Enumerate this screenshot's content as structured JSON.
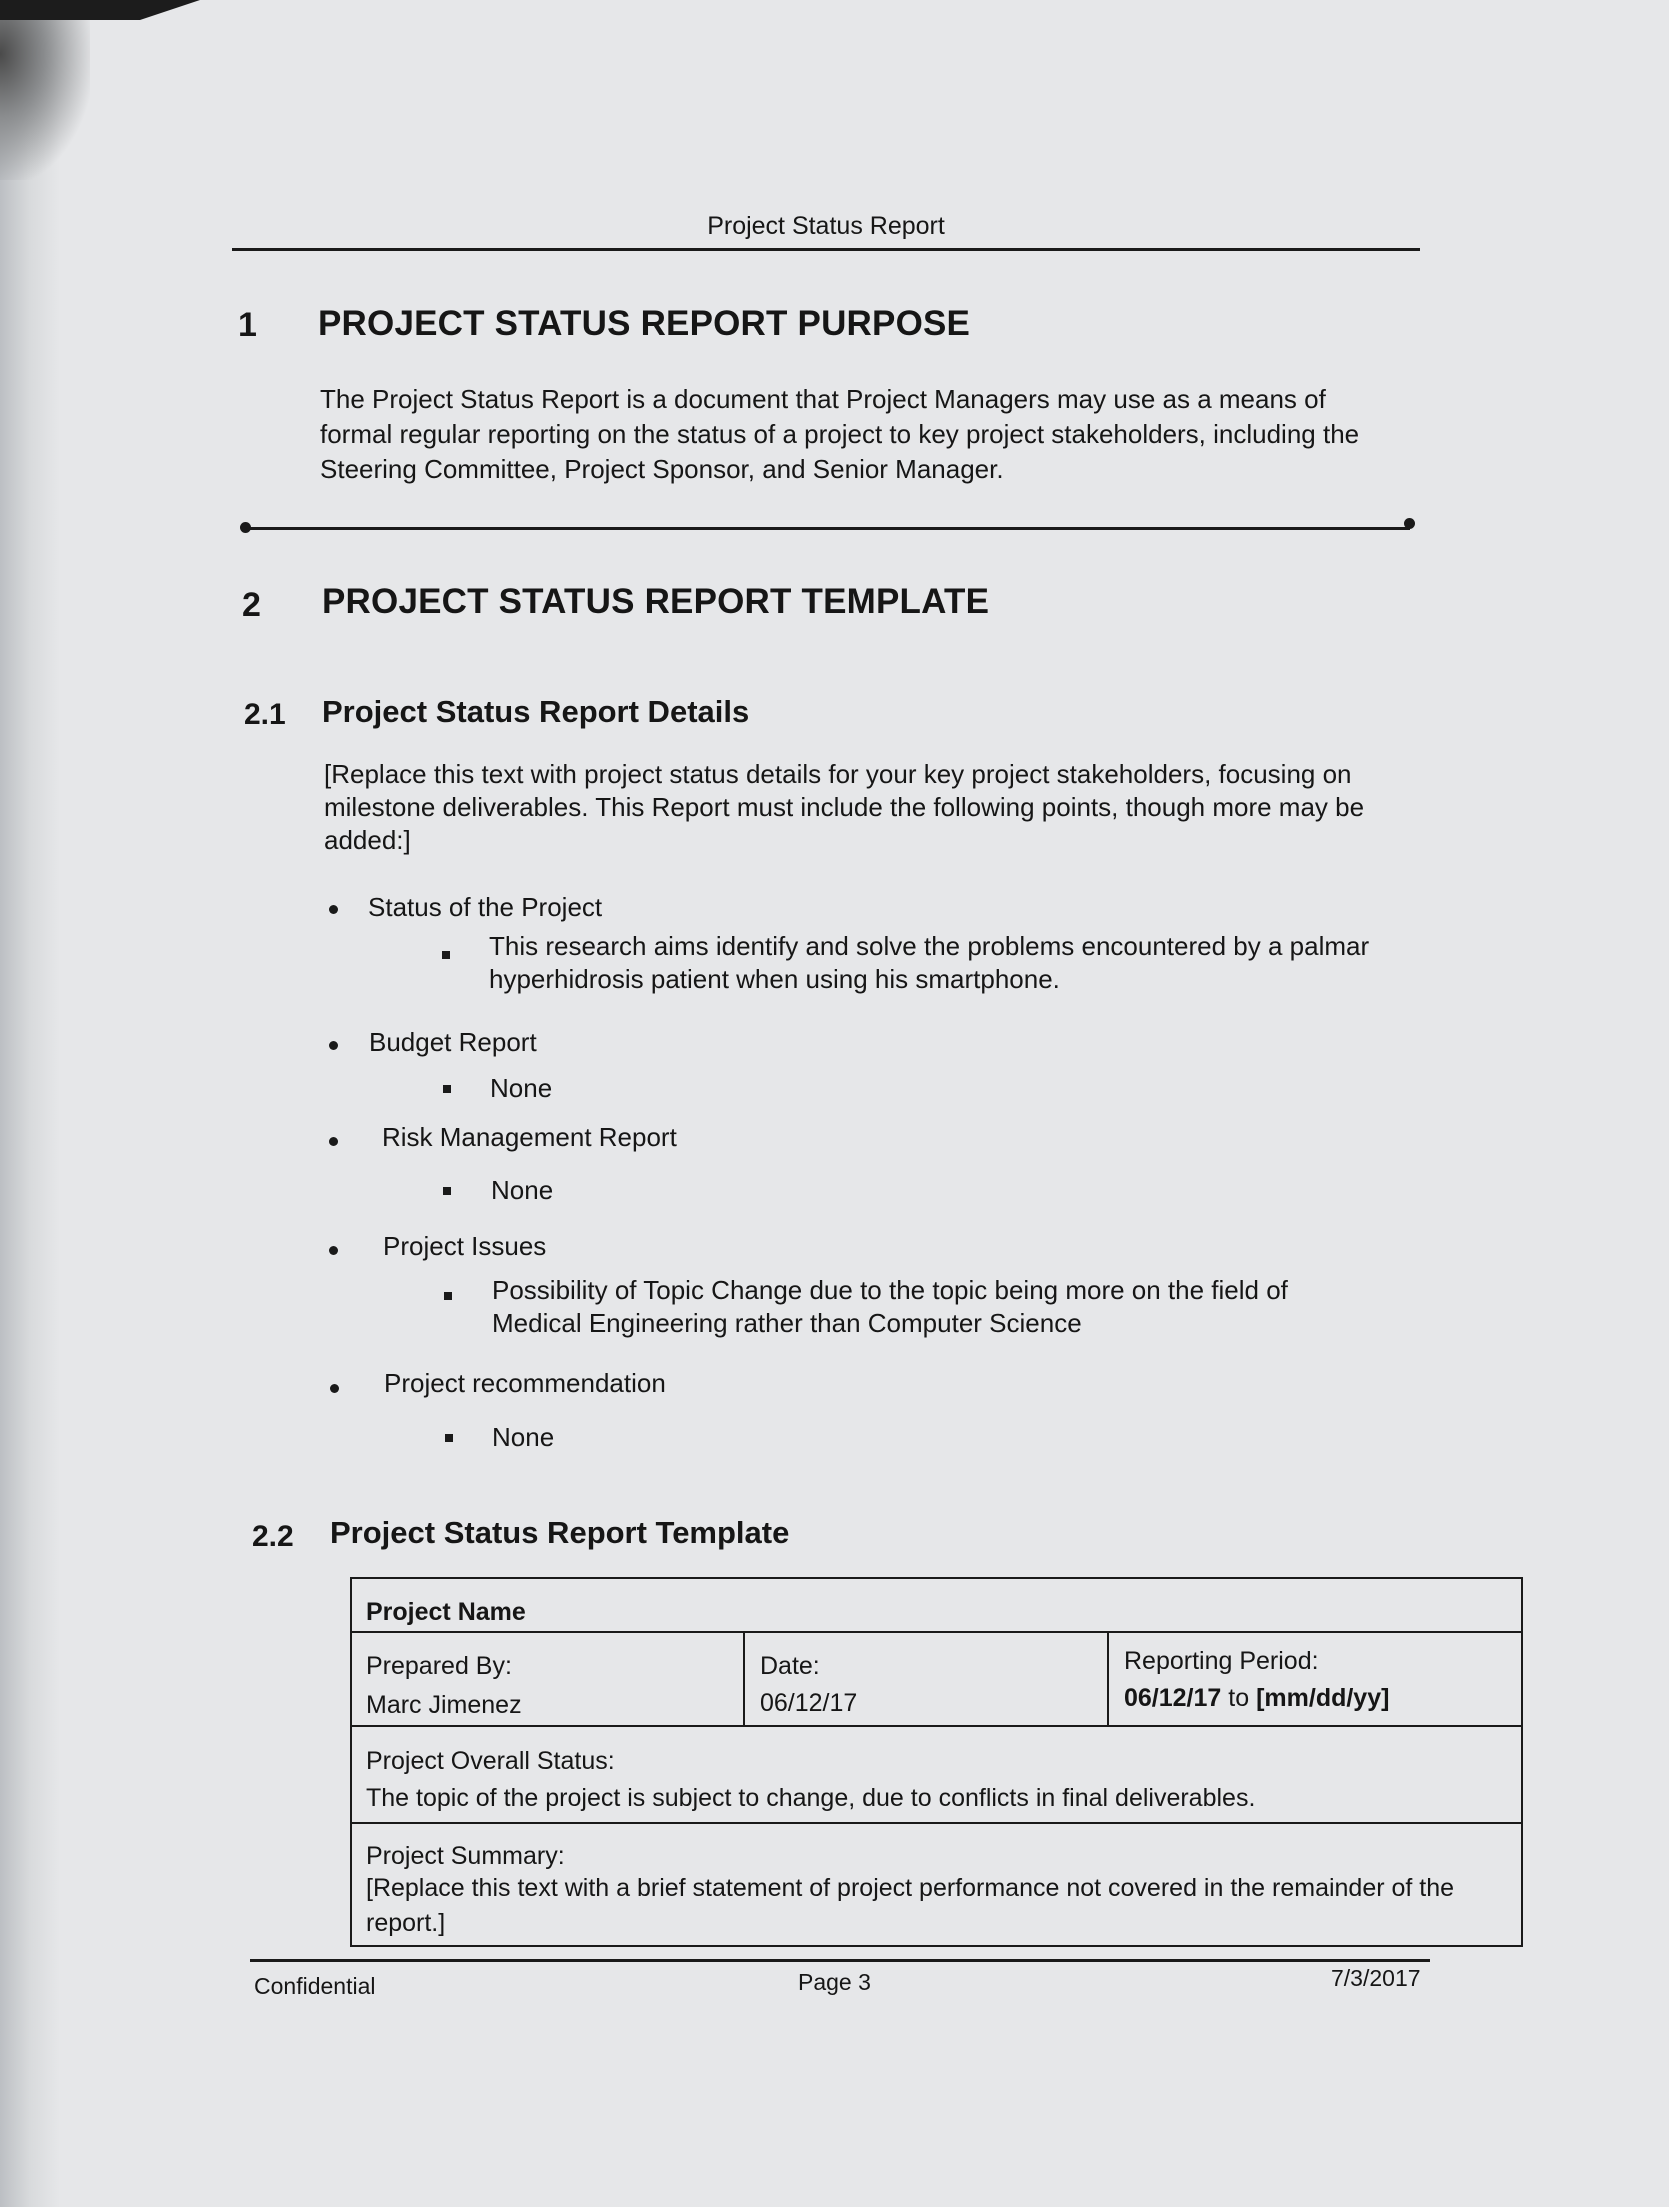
{
  "header": {
    "title": "Project Status Report"
  },
  "section1": {
    "number": "1",
    "title": "PROJECT STATUS REPORT PURPOSE",
    "lines": [
      "The Project Status Report is a document that Project Managers may use as a means of",
      "formal regular reporting on the status of a project to key project stakeholders, including the",
      "Steering Committee, Project Sponsor, and Senior Manager."
    ]
  },
  "section2": {
    "number": "2",
    "title": "PROJECT STATUS REPORT TEMPLATE"
  },
  "section2_1": {
    "number": "2.1",
    "title": "Project Status Report Details",
    "intro_lines": [
      "[Replace this text with project status details for your key project stakeholders, focusing on",
      "milestone deliverables. This Report must include the following points, though more may be",
      "added:]"
    ],
    "items": [
      {
        "label": "Status of the Project",
        "sub_lines": [
          "This research aims identify and solve the problems encountered by a palmar",
          "hyperhidrosis patient when using his smartphone."
        ]
      },
      {
        "label": "Budget Report",
        "sub_lines": [
          "None"
        ]
      },
      {
        "label": "Risk Management Report",
        "sub_lines": [
          "None"
        ]
      },
      {
        "label": "Project Issues",
        "sub_lines": [
          "Possibility of Topic Change due to the topic being more on the field of",
          "Medical Engineering rather than Computer Science"
        ]
      },
      {
        "label": "Project recommendation",
        "sub_lines": [
          "None"
        ]
      }
    ]
  },
  "section2_2": {
    "number": "2.2",
    "title": "Project Status Report Template",
    "table": {
      "project_name_label": "Project Name",
      "prepared_by_label": "Prepared By:",
      "prepared_by_value": "Marc Jimenez",
      "date_label": "Date:",
      "date_value": "06/12/17",
      "reporting_label": "Reporting Period:",
      "reporting_start": "06/12/17",
      "reporting_to": "to",
      "reporting_end": "[mm/dd/yy]",
      "overall_label": "Project Overall Status:",
      "overall_value": "The topic of the project is subject to change, due to conflicts in final deliverables.",
      "summary_label": "Project Summary:",
      "summary_lines": [
        "[Replace this text with a brief statement of project performance not covered in the remainder of the",
        "report.]"
      ]
    }
  },
  "footer": {
    "left": "Confidential",
    "center": "Page 3",
    "right": "7/3/2017"
  }
}
